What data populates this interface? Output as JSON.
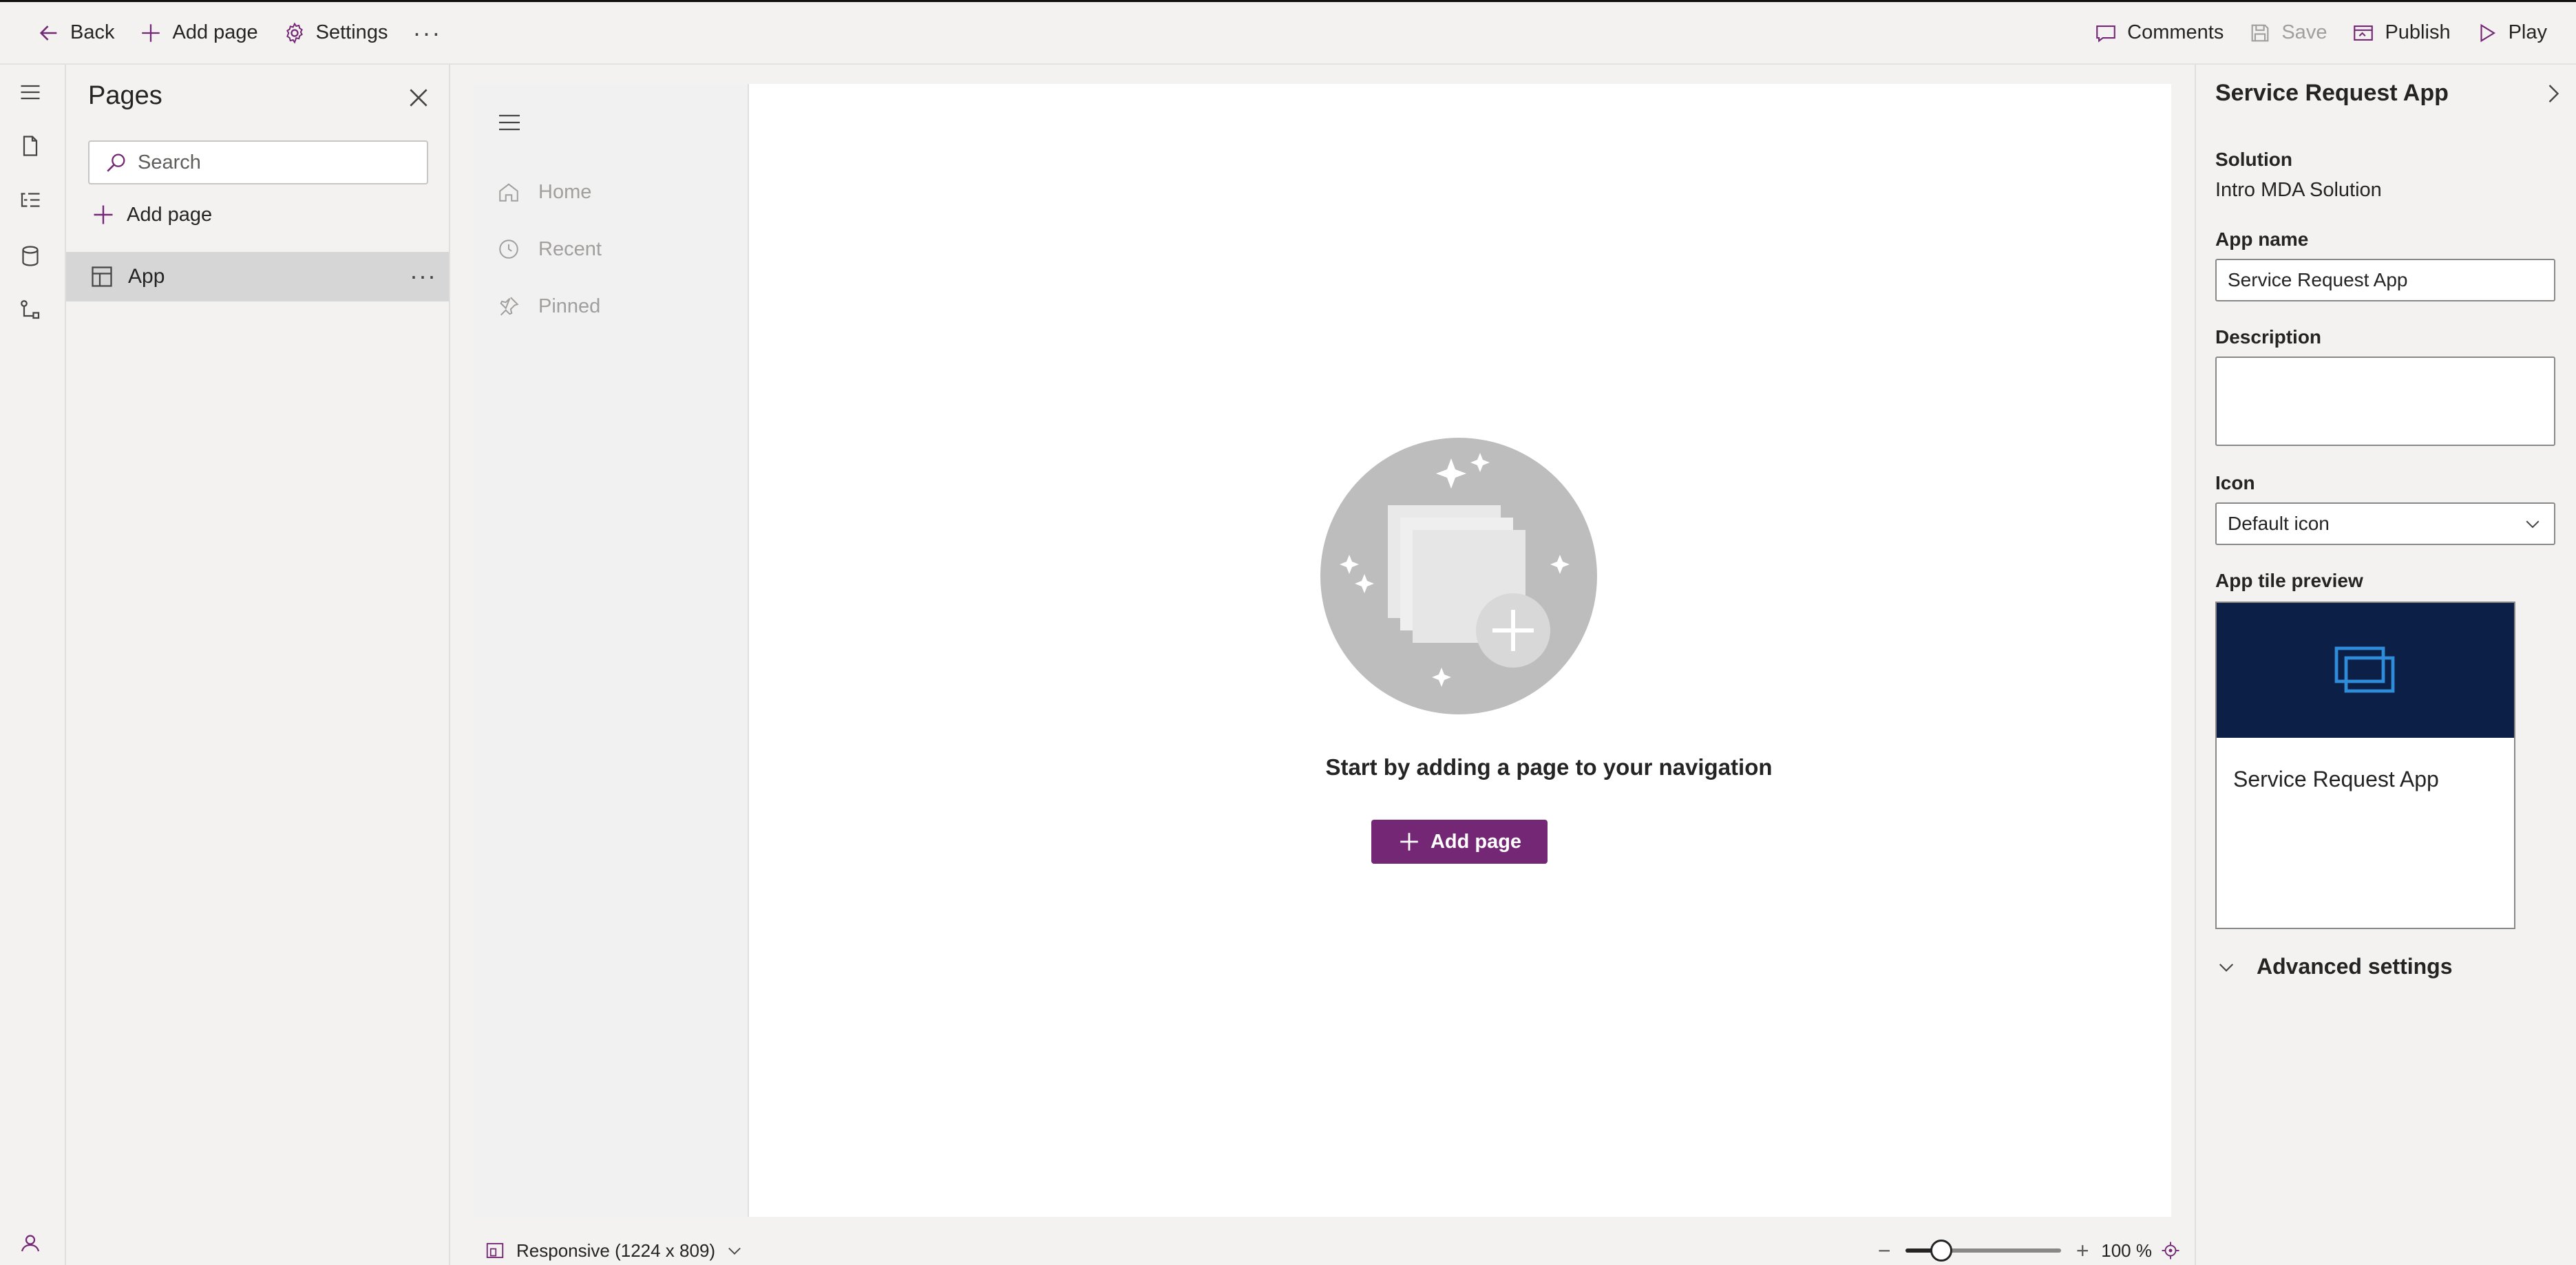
{
  "topbar": {
    "back": "Back",
    "add_page": "Add page",
    "settings": "Settings",
    "more": "···",
    "comments": "Comments",
    "save": "Save",
    "publish": "Publish",
    "play": "Play"
  },
  "pages_panel": {
    "title": "Pages",
    "search_placeholder": "Search",
    "add_page": "Add page",
    "items": [
      {
        "label": "App",
        "more": "···"
      }
    ]
  },
  "app_nav": {
    "items": [
      {
        "label": "Home",
        "icon": "home-icon"
      },
      {
        "label": "Recent",
        "icon": "clock-icon"
      },
      {
        "label": "Pinned",
        "icon": "pin-icon"
      }
    ]
  },
  "canvas": {
    "empty_message": "Start by adding a page to your navigation",
    "cta": "Add page"
  },
  "statusbar": {
    "device": "Responsive (1224 x 809)",
    "zoom_minus": "−",
    "zoom_plus": "+",
    "zoom_level": 100,
    "zoom_label": "100 %"
  },
  "properties": {
    "title": "Service Request App",
    "solution_label": "Solution",
    "solution_value": "Intro MDA Solution",
    "app_name_label": "App name",
    "app_name_value": "Service Request App",
    "description_label": "Description",
    "description_value": "",
    "icon_label": "Icon",
    "icon_value": "Default icon",
    "tile_preview_label": "App tile preview",
    "tile_name": "Service Request App",
    "advanced": "Advanced settings"
  },
  "colors": {
    "accent": "#742774",
    "tile_header": "#0c1f47",
    "tile_icon": "#2f8cd8"
  }
}
